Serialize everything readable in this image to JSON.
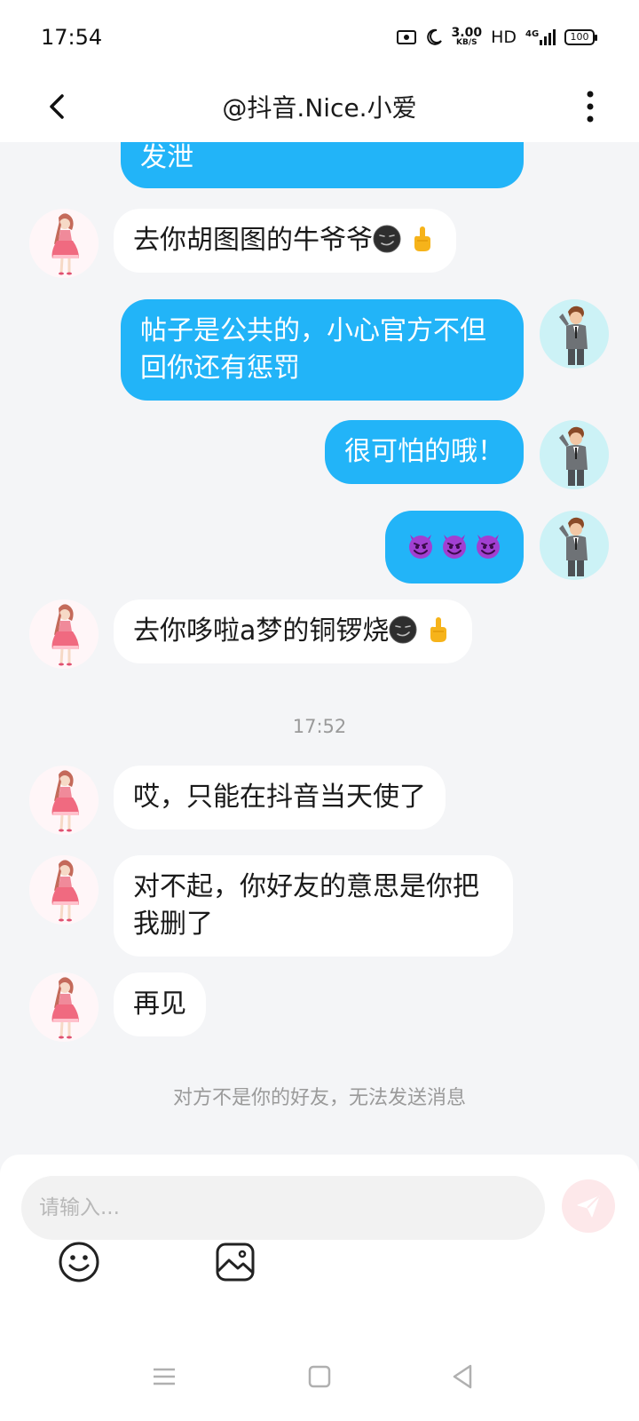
{
  "status_bar": {
    "time": "17:54",
    "net_speed_value": "3.00",
    "net_speed_unit": "KB/S",
    "hd": "HD",
    "network": "4G",
    "battery": "100"
  },
  "header": {
    "title": "@抖音.Nice.小爱"
  },
  "messages": [
    {
      "side": "out",
      "text": "发泄"
    },
    {
      "side": "in",
      "text": "去你胡图图的牛爷爷",
      "emoji": [
        "dark-smirk-face",
        "middle-finger"
      ]
    },
    {
      "side": "out",
      "text": "帖子是公共的，小心官方不但回你还有惩罚"
    },
    {
      "side": "out",
      "text": "很可怕的哦！"
    },
    {
      "side": "out",
      "text": "",
      "emoji": [
        "smiling-imp",
        "smiling-imp",
        "smiling-imp"
      ]
    },
    {
      "side": "in",
      "text": "去你哆啦a梦的铜锣烧",
      "emoji": [
        "dark-smirk-face",
        "middle-finger"
      ]
    },
    {
      "side": "in",
      "text": "哎，只能在抖音当天使了"
    },
    {
      "side": "in",
      "text": "对不起，你好友的意思是你把我删了"
    },
    {
      "side": "in",
      "text": "再见"
    }
  ],
  "timestamp": "17:52",
  "notice": "对方不是你的好友，无法发送消息",
  "composer": {
    "placeholder": "请输入..."
  },
  "colors": {
    "out_bubble": "#22b4f8",
    "in_bubble": "#ffffff",
    "background": "#f4f5f7",
    "send_button": "#fde8ea"
  },
  "icons": [
    "back-arrow-icon",
    "more-vertical-icon",
    "send-icon",
    "emoji-icon",
    "image-icon",
    "menu-icon",
    "home-icon",
    "back-triangle-icon"
  ]
}
